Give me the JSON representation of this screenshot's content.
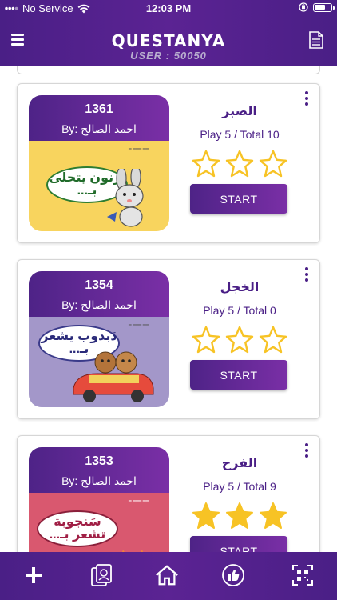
{
  "status_bar": {
    "carrier": "No Service",
    "time": "12:03 PM"
  },
  "header": {
    "logo": "QUESTANYA",
    "user_label": "USER : 50050",
    "menu_icon": "hamburger-menu-icon",
    "doc_icon": "document-list-icon"
  },
  "stories": [
    {
      "book_number": "1361",
      "author": "By: احمد الصالح",
      "cover_title": "أرنون يتحلى بـ...",
      "cover_theme": "yellow",
      "title": "الصبر",
      "meta": "Play 5 / Total 10",
      "stars_filled": 0,
      "stars_total": 3,
      "start_label": "START"
    },
    {
      "book_number": "1354",
      "author": "By: احمد الصالح",
      "cover_title": "دَبدوب يشعر بـ...",
      "cover_theme": "lavender",
      "title": "الخجل",
      "meta": "Play 5 / Total 0",
      "stars_filled": 0,
      "stars_total": 3,
      "start_label": "START"
    },
    {
      "book_number": "1353",
      "author": "By: احمد الصالح",
      "cover_title": "سَنجوبة تشعر بـ...",
      "cover_theme": "pink",
      "title": "الفرح",
      "meta": "Play 5 / Total 9",
      "stars_filled": 3,
      "stars_total": 3,
      "start_label": "START"
    }
  ],
  "bottom_nav": [
    {
      "name": "add-icon"
    },
    {
      "name": "library-icon"
    },
    {
      "name": "home-icon"
    },
    {
      "name": "like-icon"
    },
    {
      "name": "qr-scan-icon"
    }
  ],
  "colors": {
    "brand_purple": "#4a1f86",
    "accent_purple": "#7a2fa6",
    "star_gold": "#f7c325",
    "cover_yellow": "#f8d45e",
    "cover_lavender": "#a397c9",
    "cover_pink": "#d9586f"
  }
}
